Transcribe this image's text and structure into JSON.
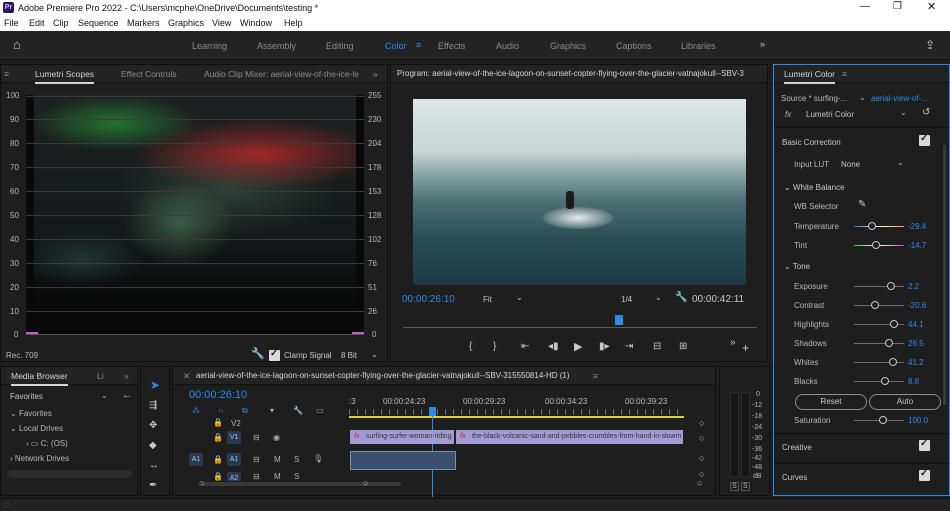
{
  "app": {
    "title": "Adobe Premiere Pro 2022 - C:\\Users\\mcphe\\OneDrive\\Documents\\testing *",
    "logo": "Pr"
  },
  "menu": [
    "File",
    "Edit",
    "Clip",
    "Sequence",
    "Markers",
    "Graphics",
    "View",
    "Window",
    "Help"
  ],
  "workspaces": [
    "Learning",
    "Assembly",
    "Editing",
    "Color",
    "Effects",
    "Audio",
    "Graphics",
    "Captions",
    "Libraries"
  ],
  "workspace_active": "Color",
  "source_panel": {
    "tabs": [
      "Lumetri Scopes",
      "Effect Controls",
      "Audio Clip Mixer: aerial-view-of-the-ice-le"
    ],
    "left_scale": [
      "100",
      "90",
      "80",
      "70",
      "60",
      "50",
      "40",
      "30",
      "20",
      "10",
      "0"
    ],
    "right_scale": [
      "255",
      "230",
      "204",
      "178",
      "153",
      "128",
      "102",
      "76",
      "51",
      "26",
      "0"
    ],
    "rec_label": "Rec. 709",
    "clamp_label": "Clamp Signal",
    "bit_depth": "8 Bit"
  },
  "program": {
    "title": "Program: aerial-view-of-the-ice-lagoon-on-sunset-copter-flying-over-the-glacier-vatnajokull--SBV-3",
    "timecode": "00:00:26:10",
    "fit": "Fit",
    "resolution": "1/4",
    "duration": "00:00:42:11",
    "playhead": 0.6
  },
  "lumetri": {
    "title": "Lumetri Color",
    "source_label": "Source * surfing-...",
    "source_clip": "aerial-view-of-...",
    "fx_name": "Lumetri Color",
    "basic_correction": "Basic Correction",
    "input_lut_label": "Input LUT",
    "input_lut_value": "None",
    "white_balance": "White Balance",
    "wb_selector": "WB Selector",
    "tone": "Tone",
    "sliders": [
      {
        "label": "Temperature",
        "value": "-29.4",
        "pos": 0.28,
        "style": "temp"
      },
      {
        "label": "Tint",
        "value": "-14.7",
        "pos": 0.36,
        "style": "tint"
      },
      {
        "label": "Exposure",
        "value": "2.2",
        "pos": 0.66,
        "style": "gray"
      },
      {
        "label": "Contrast",
        "value": "-20.6",
        "pos": 0.34,
        "style": "gray"
      },
      {
        "label": "Highlights",
        "value": "44.1",
        "pos": 0.72,
        "style": "gray"
      },
      {
        "label": "Shadows",
        "value": "26.5",
        "pos": 0.63,
        "style": "gray"
      },
      {
        "label": "Whites",
        "value": "41.2",
        "pos": 0.71,
        "style": "gray"
      },
      {
        "label": "Blacks",
        "value": "8.8",
        "pos": 0.54,
        "style": "gray"
      }
    ],
    "reset": "Reset",
    "auto": "Auto",
    "saturation_label": "Saturation",
    "saturation_value": "100.0",
    "saturation_pos": 0.5,
    "creative": "Creative",
    "curves": "Curves"
  },
  "media_browser": {
    "tabs": [
      "Media Browser",
      "Li"
    ],
    "location": "Favorites",
    "tree": [
      "Favorites",
      "Local Drives",
      "C: (OS)",
      "Network Drives"
    ]
  },
  "timeline": {
    "title": "aerial-view-of-the-ice-lagoon-on-sunset-copter-flying-over-the-glacier-vatnajokull--SBV-315550814-HD (1)",
    "timecode": "00:00:26:10",
    "ruler": [
      ":3",
      "00:00:24:23",
      "00:00:29:23",
      "00:00:34:23",
      "00:00:39:23"
    ],
    "tracks": {
      "v2": "V2",
      "v1": "V1",
      "a1": "A1",
      "a1_source": "A1",
      "a2": "A2",
      "m": "M",
      "s": "S"
    },
    "clip1": "surfing-surfer-woman-riding",
    "clip2": "the-black-volcanic-sand-and-pebbles-crumbles-from-hand-in-slowm",
    "fx_badge": "fx"
  },
  "audio_meter": {
    "scale": [
      "0",
      "-12",
      "-18",
      "-24",
      "-30",
      "-36",
      "-42",
      "-48",
      "dB"
    ],
    "solo": [
      "S",
      "S"
    ]
  },
  "colors": {
    "accent": "#2d8ceb",
    "clip": "#a39bd6",
    "panel": "#1e1e1e"
  }
}
